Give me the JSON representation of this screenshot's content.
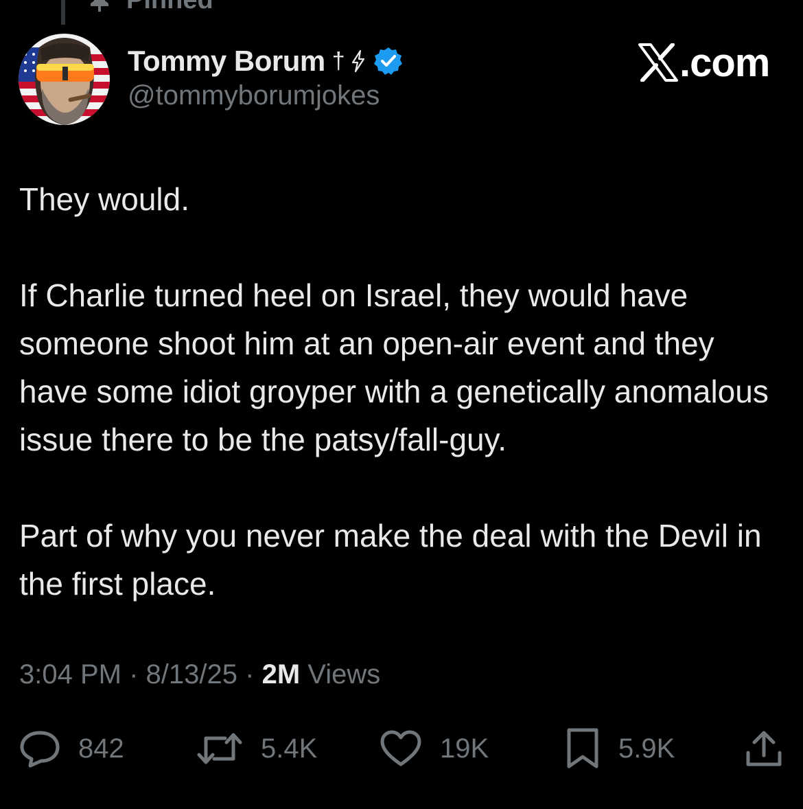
{
  "pinned": {
    "label": "Pinned"
  },
  "author": {
    "display_name": "Tommy Borum",
    "name_dagger": "†",
    "handle": "@tommyborumjokes",
    "verified": true
  },
  "brand": {
    "text": ".com"
  },
  "tweet": {
    "paragraphs": [
      "They would.",
      "If Charlie turned heel on Israel, they would have someone shoot him at an open-air event and they have some idiot groyper with a genetically anomalous issue there to be the patsy/fall-guy.",
      "Part of why you never make the deal with the Devil in the first place."
    ]
  },
  "meta": {
    "time": "3:04 PM",
    "separator": "·",
    "date": "8/13/25",
    "views_count": "2M",
    "views_label": "Views"
  },
  "actions": {
    "replies": "842",
    "reposts": "5.4K",
    "likes": "19K",
    "bookmarks": "5.9K"
  },
  "colors": {
    "background": "#000000",
    "text_primary": "#e7e9ea",
    "text_secondary": "#71767b",
    "verified_blue": "#1d9bf0"
  },
  "icons": {
    "pin": "pin-icon",
    "bolt": "lightning-bolt-icon",
    "verified": "verified-badge-icon",
    "brand": "x-logo-icon",
    "reply": "reply-bubble-icon",
    "repost": "repost-icon",
    "like": "heart-icon",
    "bookmark": "bookmark-icon",
    "share": "share-upload-icon"
  }
}
